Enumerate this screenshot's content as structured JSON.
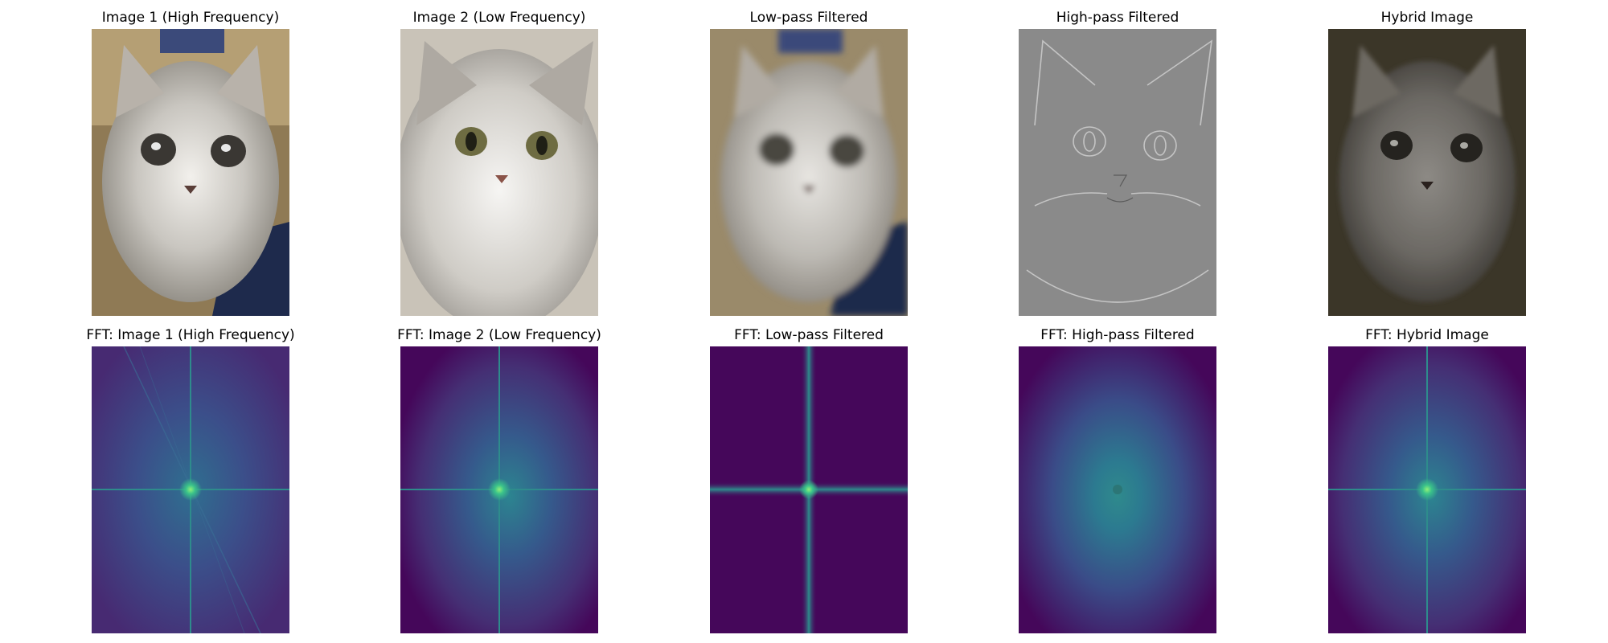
{
  "figure": {
    "panels": [
      {
        "title": "Image 1 (High Frequency)",
        "kind": "photo",
        "variant": "cat1"
      },
      {
        "title": "Image 2 (Low Frequency)",
        "kind": "photo",
        "variant": "cat2"
      },
      {
        "title": "Low-pass Filtered",
        "kind": "photo",
        "variant": "blur"
      },
      {
        "title": "High-pass Filtered",
        "kind": "photo",
        "variant": "edges"
      },
      {
        "title": "Hybrid Image",
        "kind": "photo",
        "variant": "hybrid"
      },
      {
        "title": "FFT: Image 1 (High Frequency)",
        "kind": "fft",
        "variant": "fft1"
      },
      {
        "title": "FFT: Image 2 (Low Frequency)",
        "kind": "fft",
        "variant": "fft2"
      },
      {
        "title": "FFT: Low-pass Filtered",
        "kind": "fft",
        "variant": "fftlow"
      },
      {
        "title": "FFT: High-pass Filtered",
        "kind": "fft",
        "variant": "ffthigh"
      },
      {
        "title": "FFT: Hybrid Image",
        "kind": "fft",
        "variant": "ffthybrid"
      }
    ]
  },
  "colors": {
    "fft_background": "#45075a",
    "fft_cross": "#2b8c8c",
    "fft_center": "#55d38a"
  }
}
